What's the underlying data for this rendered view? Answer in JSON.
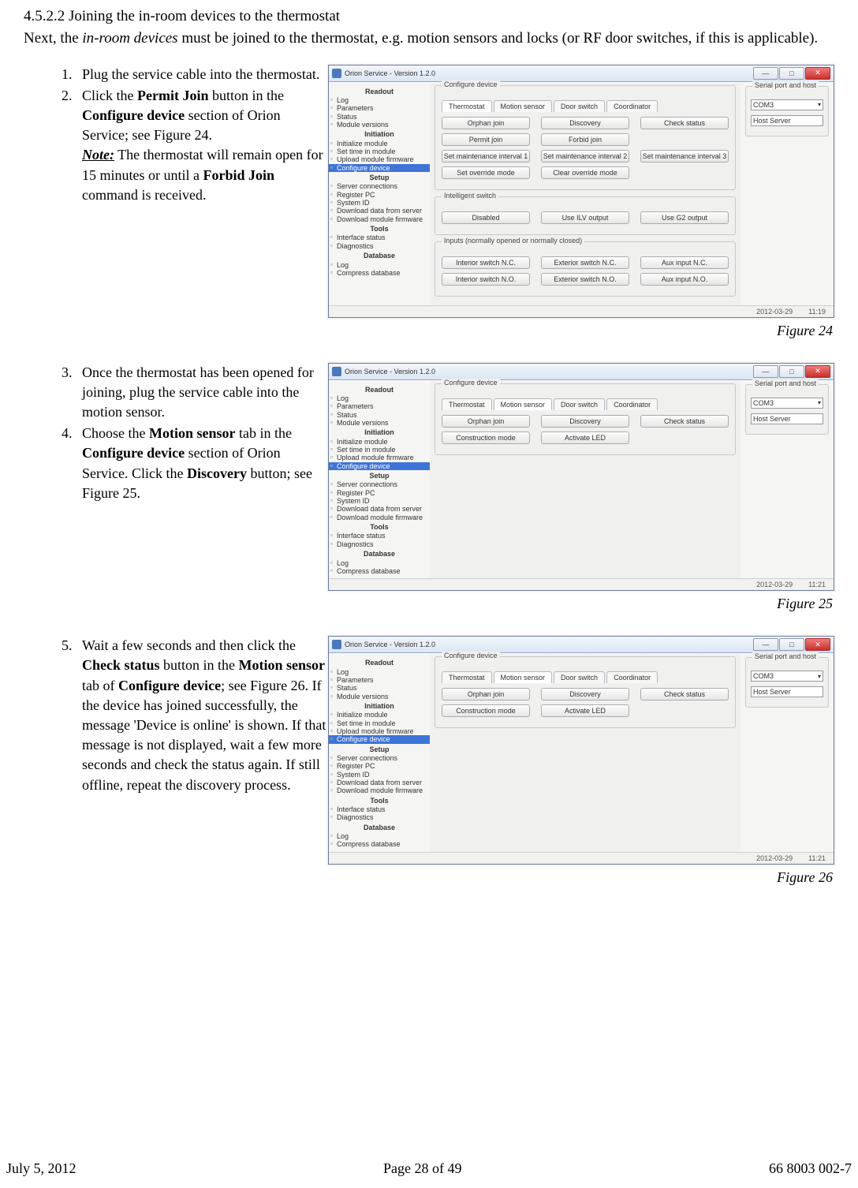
{
  "heading": "4.5.2.2 Joining the in-room devices to the thermostat",
  "intro_a": "Next, the ",
  "intro_em": "in-room devices",
  "intro_b": " must be joined to the thermostat, e.g. motion sensors and locks (or RF door switches, if this is applicable).",
  "step1": "Plug the service cable into the thermostat.",
  "step2a": "Click the ",
  "permit_join": "Permit Join",
  "step2b": " button in the ",
  "conf_dev": "Configure device",
  "step2c": " section of Orion Service; see Figure 24.",
  "note_label": "Note:",
  "note_text": " The thermostat will remain open for 15 minutes or until a ",
  "forbid_join": "Forbid Join",
  "note_text2": " command is received.",
  "step3": "Once the thermostat has been opened for joining, plug the service cable into the motion sensor.",
  "step4a": "Choose the ",
  "motion_sensor": "Motion sensor",
  "step4b": " tab in the ",
  "step4c": " section of Orion Service. Click the ",
  "discovery": "Discovery",
  "step4d": " button; see Figure 25.",
  "step5a": "Wait a few seconds and then click the ",
  "check_status": "Check status",
  "step5b": " button in the ",
  "step5c": " tab of ",
  "step5d": "; see Figure 26. If the device has joined successfully, the message 'Device is online' is shown. If that message is not displayed, wait a few more seconds and check the status again. If still offline, repeat the discovery process.",
  "cap24": "Figure 24",
  "cap25": "Figure 25",
  "cap26": "Figure 26",
  "win_title": "Orion Service - Version 1.2.0",
  "sb": {
    "readout": "Readout",
    "log": "Log",
    "params": "Parameters",
    "status": "Status",
    "modver": "Module versions",
    "init": "Initiation",
    "initmod": "Initialize module",
    "settime": "Set time in module",
    "upload": "Upload module firmware",
    "confdev": "Configure device",
    "setup": "Setup",
    "srvconn": "Server connections",
    "regpc": "Register PC",
    "sysid": "System ID",
    "dldata": "Download data from server",
    "dlfw": "Download module firmware",
    "tools": "Tools",
    "ifstatus": "Interface status",
    "diag": "Diagnostics",
    "database": "Database",
    "dblog": "Log",
    "compress": "Compress database"
  },
  "panel": {
    "conf": "Configure device",
    "tabs": {
      "thermo": "Thermostat",
      "motion": "Motion sensor",
      "door": "Door switch",
      "coord": "Coordinator"
    },
    "orphan": "Orphan join",
    "discovery": "Discovery",
    "check": "Check status",
    "permit": "Permit join",
    "forbid": "Forbid join",
    "smi1": "Set maintenance interval 1",
    "smi2": "Set maintenance interval 2",
    "smi3": "Set maintenance interval 3",
    "setov": "Set override mode",
    "clrov": "Clear override mode",
    "intswitch": "Intelligent switch",
    "disabled": "Disabled",
    "ilv": "Use ILV output",
    "g2": "Use G2 output",
    "inputs": "Inputs (normally opened or normally closed)",
    "isnc": "Interior switch N.C.",
    "esnc": "Exterior switch N.C.",
    "ainc": "Aux input N.C.",
    "isno": "Interior switch N.O.",
    "esno": "Exterior switch N.O.",
    "aino": "Aux input N.O.",
    "construct": "Construction mode",
    "actled": "Activate LED",
    "serial": "Serial port and host",
    "com": "COM3",
    "host": "Host Server"
  },
  "status": {
    "date": "2012-03-29",
    "t1": "11:19",
    "t2": "11:21"
  },
  "footer": {
    "left": "July 5, 2012",
    "mid": "Page 28 of 49",
    "right": "66 8003 002-7"
  }
}
